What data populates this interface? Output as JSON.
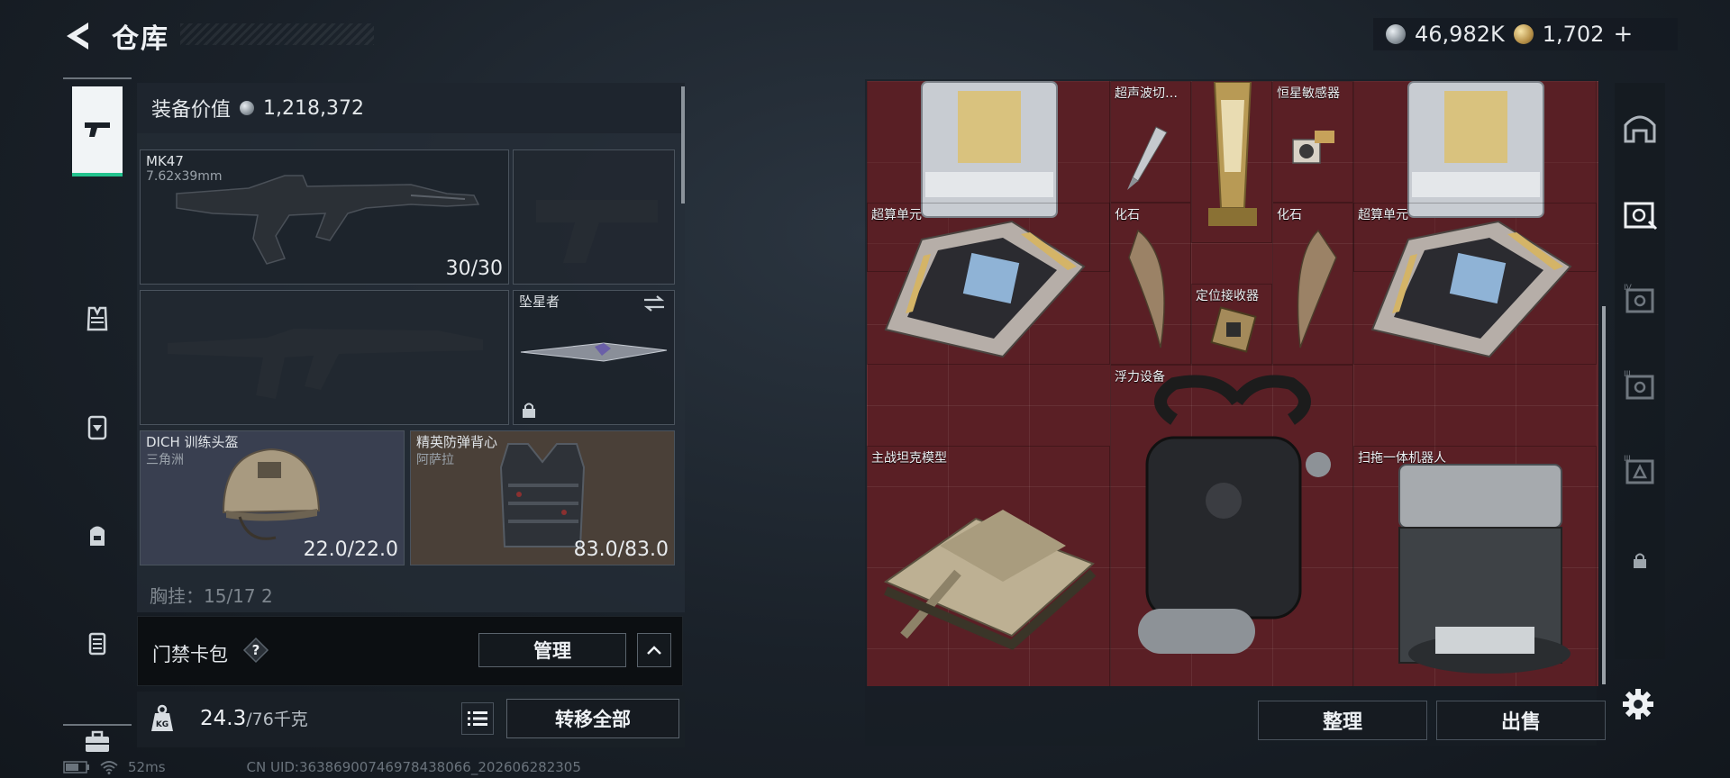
{
  "header": {
    "title": "仓库",
    "currency_silver": "46,982K",
    "currency_gold": "1,702",
    "currency_plus": "+"
  },
  "loadout": {
    "value_label": "装备价值",
    "value": "1,218,372",
    "slots": {
      "primary": {
        "name": "MK47",
        "sub": "7.62x39mm",
        "value": "30/30"
      },
      "pistol": {
        "name": "",
        "value": ""
      },
      "secondary": {
        "name": "",
        "value": ""
      },
      "melee": {
        "name": "坠星者"
      },
      "helmet": {
        "name": "DICH 训练头盔",
        "sub": "三角洲",
        "value": "22.0/22.0"
      },
      "vest": {
        "name": "精英防弹背心",
        "sub": "阿萨拉",
        "value": "83.0/83.0"
      }
    },
    "chest_row": "胸挂：15/17  2"
  },
  "card_pack": {
    "label": "门禁卡包",
    "help": "?",
    "manage": "管理"
  },
  "weight": {
    "current": "24.3",
    "max": "/76千克",
    "transfer_all": "转移全部",
    "kg": "KG"
  },
  "status": {
    "ping": "52ms",
    "uid": "CN UID:3638690074697843806​6_202606282305"
  },
  "storage": {
    "items": [
      {
        "name": ""
      },
      {
        "name": "超声波切…"
      },
      {
        "name": ""
      },
      {
        "name": "恒星敏感器"
      },
      {
        "name": ""
      },
      {
        "name": "超算单元"
      },
      {
        "name": "化石"
      },
      {
        "name": "化石"
      },
      {
        "name": "超算单元"
      },
      {
        "name": "定位接收器"
      },
      {
        "name": "浮力设备"
      },
      {
        "name": "主战坦克模型"
      },
      {
        "name": "扫拖一体机器人"
      }
    ],
    "sort": "整理",
    "sell": "出售"
  },
  "colors": {
    "grid_bg": "#5a1f25",
    "active_tab": "#23c38e"
  }
}
